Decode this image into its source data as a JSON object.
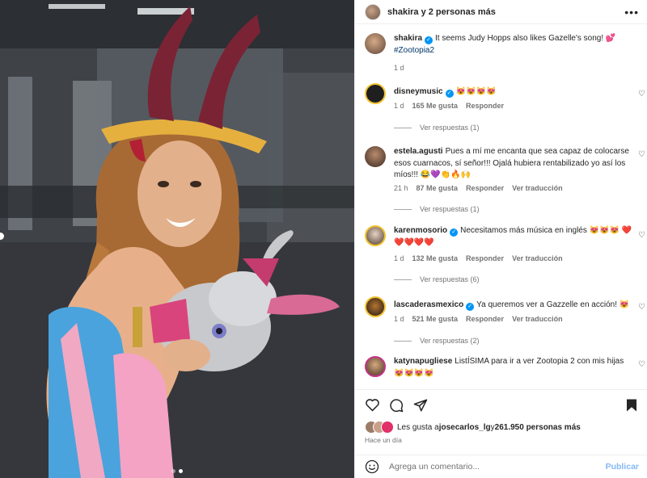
{
  "header": {
    "title": "shakira y 2 personas más",
    "more_icon": "more-horizontal-icon"
  },
  "caption": {
    "username": "shakira",
    "text": "It seems Judy Hopps also likes Gazelle's song! 💕",
    "hashtag": "#Zootopia2",
    "time": "1 d"
  },
  "comments": [
    {
      "username": "disneymusic",
      "verified": true,
      "text": "😻😻😻😻",
      "time": "1 d",
      "likes": "165 Me gusta",
      "reply": "Responder",
      "translate": "",
      "replies": "Ver respuestas (1)"
    },
    {
      "username": "estela.agusti",
      "verified": false,
      "text": "Pues a mí me encanta que sea capaz de colocarse esos cuarnacos, sí señor!!! Ojalá hubiera rentabilizado yo así los míos!!! 😂💜👏🔥🙌",
      "time": "21 h",
      "likes": "87 Me gusta",
      "reply": "Responder",
      "translate": "Ver traducción",
      "replies": "Ver respuestas (1)"
    },
    {
      "username": "karenmosorio",
      "verified": true,
      "text": "Necesitamos más música en inglés 😻😻😻 ❤️❤️❤️❤️❤️",
      "time": "1 d",
      "likes": "132 Me gusta",
      "reply": "Responder",
      "translate": "Ver traducción",
      "replies": "Ver respuestas (6)"
    },
    {
      "username": "lascaderasmexico",
      "verified": true,
      "text": "Ya queremos ver a Gazzelle en acción! 😻",
      "time": "1 d",
      "likes": "521 Me gusta",
      "reply": "Responder",
      "translate": "Ver traducción",
      "replies": "Ver respuestas (2)"
    },
    {
      "username": "katynapugliese",
      "verified": false,
      "text": "ListÍSIMA para ir a ver Zootopia 2 con mis hijas 😻😻😻😻",
      "time": "",
      "likes": "",
      "reply": "",
      "translate": "",
      "replies": ""
    }
  ],
  "likes_line": {
    "prefix": "Les gusta a ",
    "user": "josecarlos_lg",
    "middle": " y ",
    "count": "261.950 personas más"
  },
  "posted_ago": "Hace un día",
  "composer": {
    "placeholder": "Agrega un comentario...",
    "publish": "Publicar"
  },
  "colors": {
    "verified": "#0095f6",
    "publish": "#85b8f5",
    "hashtag": "#00376b"
  }
}
